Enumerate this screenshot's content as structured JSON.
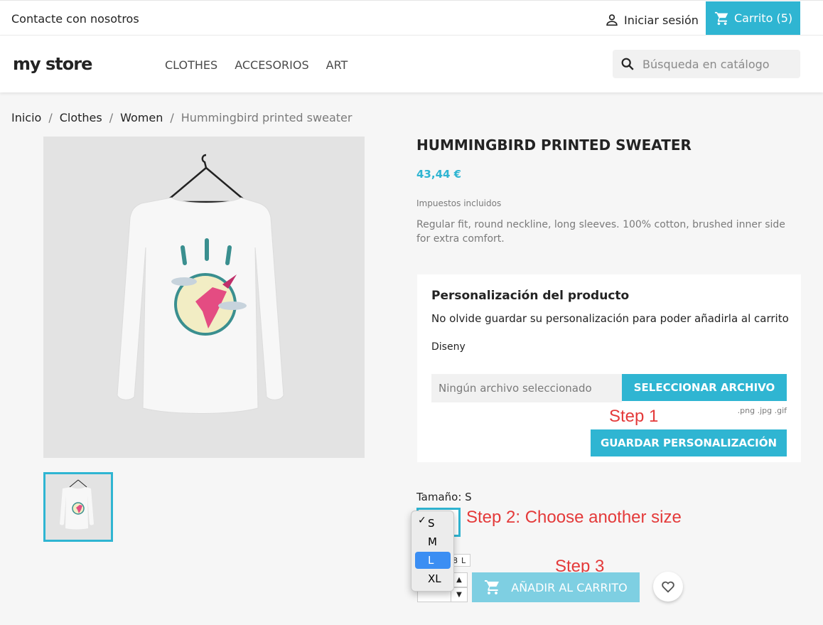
{
  "topbar": {
    "contact": "Contacte con nosotros",
    "signin": "Iniciar sesión",
    "cart": "Carrito (5)"
  },
  "header": {
    "logo": "my store",
    "nav": [
      "CLOTHES",
      "ACCESORIOS",
      "ART"
    ],
    "search_placeholder": "Búsqueda en catálogo"
  },
  "breadcrumb": [
    "Inicio",
    "Clothes",
    "Women",
    "Hummingbird printed sweater"
  ],
  "product": {
    "title": "HUMMINGBIRD PRINTED SWEATER",
    "price": "43,44 €",
    "tax": "Impuestos incluidos",
    "description": "Regular fit, round neckline, long sleeves. 100% cotton, brushed inner side for extra comfort."
  },
  "customization": {
    "title": "Personalización del producto",
    "note": "No olvide guardar su personalización para poder añadirla al carrito",
    "field_label": "Diseny",
    "file_placeholder": "Ningún archivo seleccionado",
    "file_button": "SELECCIONAR ARCHIVO",
    "file_types": ".png .jpg .gif",
    "save_button": "GUARDAR PERSONALIZACIÓN"
  },
  "annotations": {
    "step1": "Step 1",
    "step2": "Step 2: Choose another size",
    "step3": "Step 3"
  },
  "size": {
    "label": "Tamaño: S",
    "options": [
      "S",
      "M",
      "L",
      "XL"
    ],
    "selected": "S",
    "highlighted": "L",
    "check": "✓"
  },
  "quantity": {
    "hint_partial": "8",
    "hint_letter": "L"
  },
  "add_to_cart": "AÑADIR AL CARRITO",
  "colors": {
    "accent": "#2fb5d2",
    "highlight": "#3b8ef3",
    "annotation": "#e43a3a"
  }
}
